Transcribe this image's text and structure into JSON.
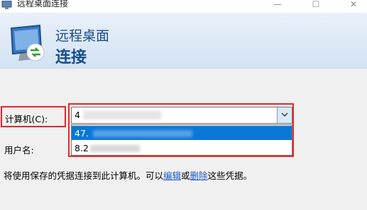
{
  "window": {
    "title": "远程桌面连接",
    "min": "—",
    "max": "☐",
    "close": "✕"
  },
  "header": {
    "line1": "远程桌面",
    "line2": "连接"
  },
  "form": {
    "computer_label": "计算机(C):",
    "computer_value": "4",
    "user_label": "用户名:",
    "dropdown_options": [
      "47.",
      "8.2"
    ]
  },
  "note": {
    "prefix": "将使用保存的凭据连接到此计算机。可以",
    "edit_link": "编辑",
    "or": "或",
    "delete_link": "删除",
    "suffix": "这些凭据。"
  },
  "colors": {
    "highlight_border": "#e8252a",
    "selection": "#0a78d7",
    "header_text": "#1a4c8c",
    "link": "#1a58c9"
  },
  "icons": {
    "app": "remote-desktop-icon",
    "dropdown": "chevron-down-icon"
  }
}
